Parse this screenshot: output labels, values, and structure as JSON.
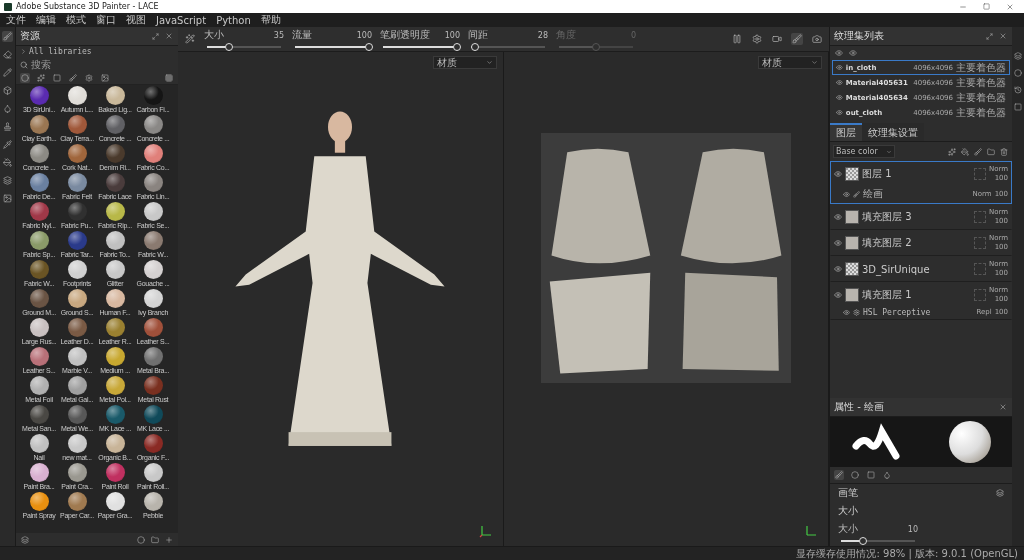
{
  "window": {
    "title": "Adobe Substance 3D Painter - LACE"
  },
  "menu": [
    "文件",
    "编辑",
    "模式",
    "窗口",
    "视图",
    "JavaScript",
    "Python",
    "帮助"
  ],
  "toolbar": {
    "sliders": [
      {
        "label": "大小",
        "value": "35",
        "level": 0.3,
        "disabled": false
      },
      {
        "label": "流量",
        "value": "100",
        "level": 1,
        "disabled": false
      },
      {
        "label": "笔刷透明度",
        "value": "100",
        "level": 1,
        "disabled": false
      },
      {
        "label": "间距",
        "value": "28",
        "level": 0.05,
        "disabled": false
      },
      {
        "label": "角度",
        "value": "0",
        "level": 0.5,
        "disabled": true
      }
    ]
  },
  "assets": {
    "title": "资源",
    "breadcrumb": "All libraries",
    "search": {
      "placeholder": "搜索"
    },
    "materials": [
      {
        "name": "3D SirUni...",
        "color": "#5a2bb0"
      },
      {
        "name": "Autumn L...",
        "color": "#e0ddd8"
      },
      {
        "name": "Baked Lig...",
        "color": "#c9b89a"
      },
      {
        "name": "Carbon Fi...",
        "color": "#151515"
      },
      {
        "name": "Clay Earth...",
        "color": "#9a7652"
      },
      {
        "name": "Clay Terra...",
        "color": "#a0583a"
      },
      {
        "name": "Concrete ...",
        "color": "#606064"
      },
      {
        "name": "Concrete ...",
        "color": "#8a8886"
      },
      {
        "name": "Concrete ...",
        "color": "#8c8a84"
      },
      {
        "name": "Cork Nat...",
        "color": "#a0663c"
      },
      {
        "name": "Denim Ri...",
        "color": "#4a3a2c"
      },
      {
        "name": "Fabric Co...",
        "color": "#e0807a"
      },
      {
        "name": "Fabric De...",
        "color": "#6a80a0"
      },
      {
        "name": "Fabric Felt",
        "color": "#7a8aa0"
      },
      {
        "name": "Fabric Lace",
        "color": "#4a3c3c"
      },
      {
        "name": "Fabric Lin...",
        "color": "#8a8480"
      },
      {
        "name": "Fabric Nyl...",
        "color": "#a03848"
      },
      {
        "name": "Fabric Pu...",
        "color": "#303030"
      },
      {
        "name": "Fabric Rip...",
        "color": "#b8b848"
      },
      {
        "name": "Fabric Se...",
        "color": "#c8c8c8"
      },
      {
        "name": "Fabric Sp...",
        "color": "#8a9a68"
      },
      {
        "name": "Fabric Tar...",
        "color": "#2a3a8a"
      },
      {
        "name": "Fabric To...",
        "color": "#c0c0c0"
      },
      {
        "name": "Fabric W...",
        "color": "#8a7a70"
      },
      {
        "name": "Fabric W...",
        "color": "#6a5424"
      },
      {
        "name": "Footprints",
        "color": "#d0d0d0"
      },
      {
        "name": "Glitter",
        "color": "#c8c8c8"
      },
      {
        "name": "Gouache ...",
        "color": "#d4d0d0"
      },
      {
        "name": "Ground M...",
        "color": "#6a5444"
      },
      {
        "name": "Ground S...",
        "color": "#c8a880"
      },
      {
        "name": "Human F...",
        "color": "#d8b8a0"
      },
      {
        "name": "Ivy Branch",
        "color": "#d4d4d4"
      },
      {
        "name": "Large Rus...",
        "color": "#c8c0c0"
      },
      {
        "name": "Leather D...",
        "color": "#7a5a44"
      },
      {
        "name": "Leather R...",
        "color": "#9a8030"
      },
      {
        "name": "Leather S...",
        "color": "#a0503a"
      },
      {
        "name": "Leather S...",
        "color": "#b87078"
      },
      {
        "name": "Marble V...",
        "color": "#c0c0c0"
      },
      {
        "name": "Medium ...",
        "color": "#c8a830"
      },
      {
        "name": "Metal Bra...",
        "color": "#707070"
      },
      {
        "name": "Metal Foil",
        "color": "#b0b0b0"
      },
      {
        "name": "Metal Gal...",
        "color": "#a0a0a0"
      },
      {
        "name": "Metal Pol...",
        "color": "#c8a838"
      },
      {
        "name": "Metal Rust",
        "color": "#7a3020"
      },
      {
        "name": "Metal San...",
        "color": "#4a4844"
      },
      {
        "name": "Metal We...",
        "color": "#585858"
      },
      {
        "name": "MK Lace ...",
        "color": "#1a5a6a"
      },
      {
        "name": "MK Lace ...",
        "color": "#104a5a"
      },
      {
        "name": "Nail",
        "color": "#c0c0c0"
      },
      {
        "name": "new mat...",
        "color": "#c8c8c8"
      },
      {
        "name": "Organic B...",
        "color": "#c8b498"
      },
      {
        "name": "Organic F...",
        "color": "#8a2a24"
      },
      {
        "name": "Paint Bra...",
        "color": "#d8b0d0"
      },
      {
        "name": "Paint Cra...",
        "color": "#9a9890"
      },
      {
        "name": "Paint Roll",
        "color": "#c03060"
      },
      {
        "name": "Paint Roll...",
        "color": "#c8c8c8"
      },
      {
        "name": "Paint Spray",
        "color": "#e89010"
      },
      {
        "name": "Paper Car...",
        "color": "#a07a50"
      },
      {
        "name": "Paper Gra...",
        "color": "#e0e0e0"
      },
      {
        "name": "Pebble",
        "color": "#b8b4ac"
      }
    ]
  },
  "viewports": [
    {
      "mode": "材质"
    },
    {
      "mode": "材质"
    }
  ],
  "texture_sets": {
    "title": "纹理集列表",
    "items": [
      {
        "name": "in_cloth",
        "size": "4096x4096",
        "shader": "主要着色器",
        "selected": true
      },
      {
        "name": "Material405631",
        "size": "4096x4096",
        "shader": "主要着色器",
        "selected": false
      },
      {
        "name": "Material405634",
        "size": "4096x4096",
        "shader": "主要着色器",
        "selected": false
      },
      {
        "name": "out_cloth",
        "size": "4096x4096",
        "shader": "主要着色器",
        "selected": false
      }
    ]
  },
  "layer_tabs": [
    {
      "label": "图层",
      "selected": true
    },
    {
      "label": "纹理集设置",
      "selected": false
    }
  ],
  "channel": "Base color",
  "layers": [
    {
      "kind": "paint",
      "name": "图层 1",
      "blend": "Norm",
      "opacity": "100",
      "selected": true,
      "effects": [
        {
          "kind": "paint",
          "name": "绘画",
          "blend": "Norm",
          "opacity": "100"
        }
      ]
    },
    {
      "kind": "fill",
      "name": "填充图层 3",
      "blend": "Norm",
      "opacity": "100",
      "selected": false
    },
    {
      "kind": "fill",
      "name": "填充图层 2",
      "blend": "Norm",
      "opacity": "100",
      "selected": false
    },
    {
      "kind": "paint",
      "name": "3D_SirUnique",
      "blend": "Norm",
      "opacity": "100",
      "selected": false
    },
    {
      "kind": "fill",
      "name": "填充图层 1",
      "blend": "Norm",
      "opacity": "100",
      "selected": false,
      "effects": [
        {
          "kind": "filter",
          "name": "HSL Perceptive",
          "blend": "Repl",
          "opacity": "100"
        }
      ]
    }
  ],
  "properties": {
    "title": "属性 - 绘画",
    "section": "画笔",
    "group": "大小",
    "slider": {
      "label": "大小",
      "value": "10",
      "level": 0.3
    }
  },
  "status_bar": "显存缓存使用情况: 98% | 版本: 9.0.1 (OpenGL)"
}
